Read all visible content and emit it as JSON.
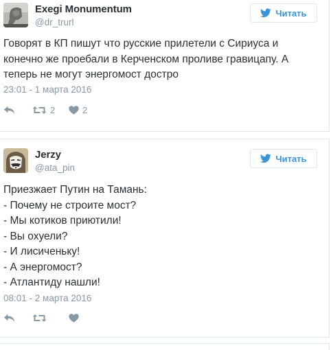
{
  "colors": {
    "accent": "#3b94d9",
    "muted": "#8899a6",
    "text": "#292f33",
    "border": "#e1e8ed"
  },
  "tweets": [
    {
      "name": "Exegi Monumentum",
      "handle": "@dr_trurl",
      "follow_label": "Читать",
      "follow_icon": "twitter-bird-icon",
      "text": "Говорят в КП пишут что русские прилетели с Сириуса и конечно же проебали в Керченском проливе гравицапу. А теперь не могут энергомост достро",
      "timestamp": "23:01 - 1 марта 2016",
      "reply_icon": "reply-icon",
      "retweet_icon": "retweet-icon",
      "like_icon": "heart-icon",
      "retweets": "2",
      "likes": "2"
    },
    {
      "name": "Jerzy",
      "handle": "@ata_pin",
      "follow_label": "Читать",
      "follow_icon": "twitter-bird-icon",
      "text": "Приезжает Путин на Тамань:\n- Почему не строите мост?\n- Мы котиков приютили!\n- Вы охуели?\n- И лисиченьку!\n- А энергомост?\n- Атлантиду нашли!",
      "timestamp": "08:01 - 2 марта 2016",
      "reply_icon": "reply-icon",
      "retweet_icon": "retweet-icon",
      "like_icon": "heart-icon",
      "retweets": "",
      "likes": ""
    }
  ]
}
